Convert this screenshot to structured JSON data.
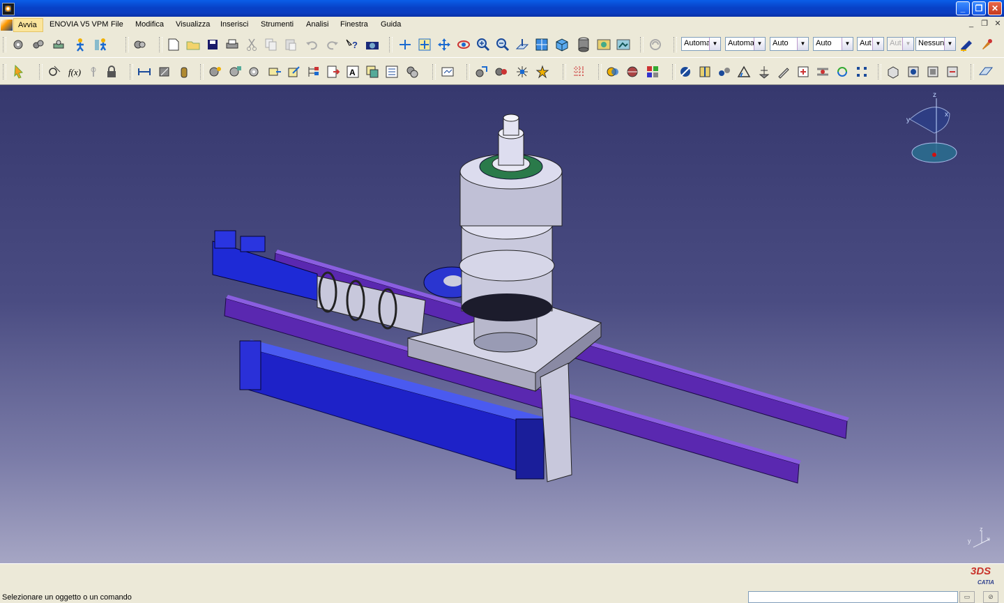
{
  "window": {
    "minimize": "_",
    "maximize": "❐",
    "close": "✕"
  },
  "menubar": {
    "items": [
      "Avvia",
      "ENOVIA V5 VPM",
      "File",
      "Modifica",
      "Visualizza",
      "Inserisci",
      "Strumenti",
      "Analisi",
      "Finestra",
      "Guida"
    ],
    "mdi": {
      "minimize": "_",
      "restore": "❐",
      "close": "✕"
    }
  },
  "toolbar": {
    "dropdowns": [
      {
        "value": "Automa",
        "enabled": true
      },
      {
        "value": "Automa",
        "enabled": true
      },
      {
        "value": "Auto",
        "enabled": true
      },
      {
        "value": "Auto",
        "enabled": true
      },
      {
        "value": "Aut",
        "enabled": true
      },
      {
        "value": "Aut",
        "enabled": false
      },
      {
        "value": "Nessuno",
        "enabled": true
      }
    ]
  },
  "compass": {
    "z": "z",
    "y": "y",
    "x": "x"
  },
  "axis_triad": {
    "z": "z",
    "y": "y",
    "x": "x"
  },
  "logo": {
    "mark": "3DS",
    "name": "CATIA"
  },
  "status": {
    "message": "Selezionare un oggetto o un comando",
    "command_input": "",
    "buttons": [
      "▭",
      "⊘"
    ]
  },
  "colors": {
    "titlebar": "#0a4fd8",
    "viewport_top": "#36386e",
    "viewport_bottom": "#a6a6c4",
    "rail": "#6a32c8",
    "actuator": "#2233dd",
    "spindle": "#c9c9dd"
  }
}
